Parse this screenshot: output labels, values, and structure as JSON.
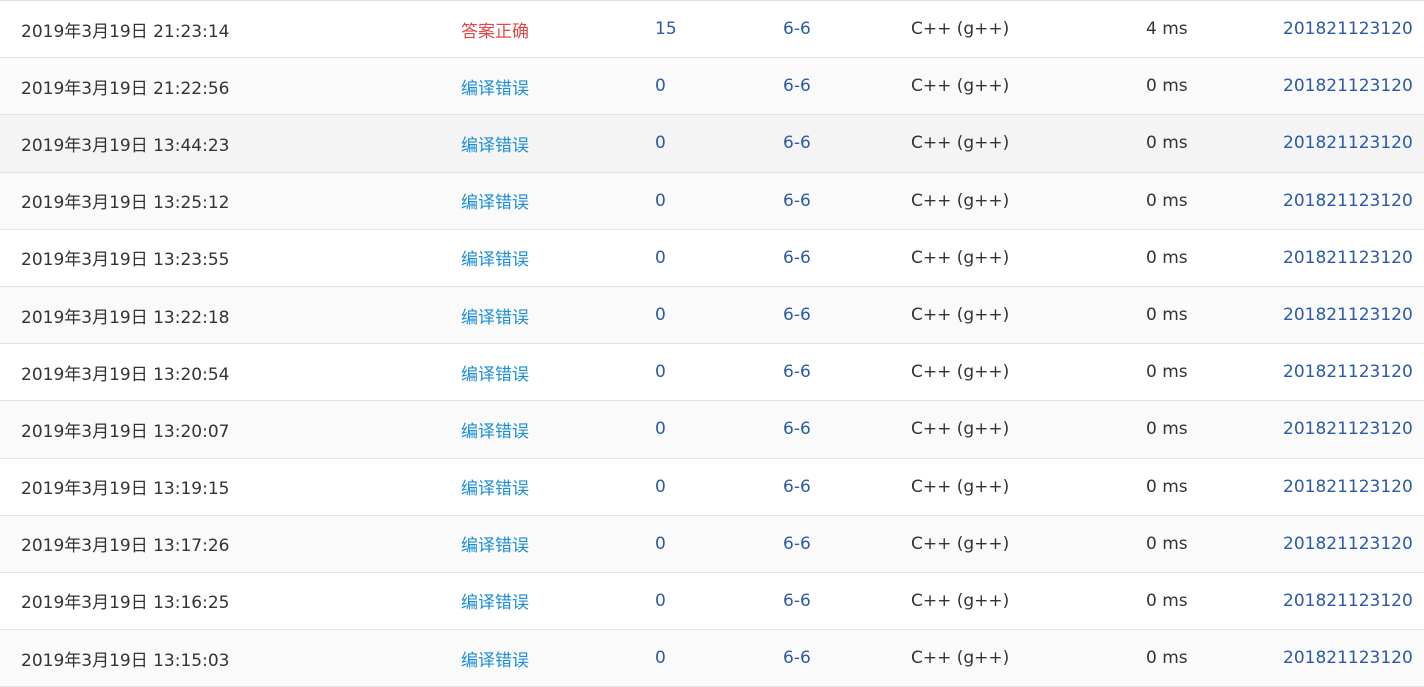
{
  "colors": {
    "accepted": "#e04747",
    "compile_error": "#1a8ed6",
    "link": "#2a5aa8",
    "text": "#333333"
  },
  "submissions": [
    {
      "time": "2019年3月19日 21:23:14",
      "status": "答案正确",
      "status_type": "accepted",
      "score": "15",
      "problem": "6-6",
      "language": "C++ (g++)",
      "run_time": "4 ms",
      "user": "201821123120"
    },
    {
      "time": "2019年3月19日 21:22:56",
      "status": "编译错误",
      "status_type": "compile_error",
      "score": "0",
      "problem": "6-6",
      "language": "C++ (g++)",
      "run_time": "0 ms",
      "user": "201821123120"
    },
    {
      "time": "2019年3月19日 13:44:23",
      "status": "编译错误",
      "status_type": "compile_error",
      "score": "0",
      "problem": "6-6",
      "language": "C++ (g++)",
      "run_time": "0 ms",
      "user": "201821123120"
    },
    {
      "time": "2019年3月19日 13:25:12",
      "status": "编译错误",
      "status_type": "compile_error",
      "score": "0",
      "problem": "6-6",
      "language": "C++ (g++)",
      "run_time": "0 ms",
      "user": "201821123120"
    },
    {
      "time": "2019年3月19日 13:23:55",
      "status": "编译错误",
      "status_type": "compile_error",
      "score": "0",
      "problem": "6-6",
      "language": "C++ (g++)",
      "run_time": "0 ms",
      "user": "201821123120"
    },
    {
      "time": "2019年3月19日 13:22:18",
      "status": "编译错误",
      "status_type": "compile_error",
      "score": "0",
      "problem": "6-6",
      "language": "C++ (g++)",
      "run_time": "0 ms",
      "user": "201821123120"
    },
    {
      "time": "2019年3月19日 13:20:54",
      "status": "编译错误",
      "status_type": "compile_error",
      "score": "0",
      "problem": "6-6",
      "language": "C++ (g++)",
      "run_time": "0 ms",
      "user": "201821123120"
    },
    {
      "time": "2019年3月19日 13:20:07",
      "status": "编译错误",
      "status_type": "compile_error",
      "score": "0",
      "problem": "6-6",
      "language": "C++ (g++)",
      "run_time": "0 ms",
      "user": "201821123120"
    },
    {
      "time": "2019年3月19日 13:19:15",
      "status": "编译错误",
      "status_type": "compile_error",
      "score": "0",
      "problem": "6-6",
      "language": "C++ (g++)",
      "run_time": "0 ms",
      "user": "201821123120"
    },
    {
      "time": "2019年3月19日 13:17:26",
      "status": "编译错误",
      "status_type": "compile_error",
      "score": "0",
      "problem": "6-6",
      "language": "C++ (g++)",
      "run_time": "0 ms",
      "user": "201821123120"
    },
    {
      "time": "2019年3月19日 13:16:25",
      "status": "编译错误",
      "status_type": "compile_error",
      "score": "0",
      "problem": "6-6",
      "language": "C++ (g++)",
      "run_time": "0 ms",
      "user": "201821123120"
    },
    {
      "time": "2019年3月19日 13:15:03",
      "status": "编译错误",
      "status_type": "compile_error",
      "score": "0",
      "problem": "6-6",
      "language": "C++ (g++)",
      "run_time": "0 ms",
      "user": "201821123120"
    }
  ]
}
